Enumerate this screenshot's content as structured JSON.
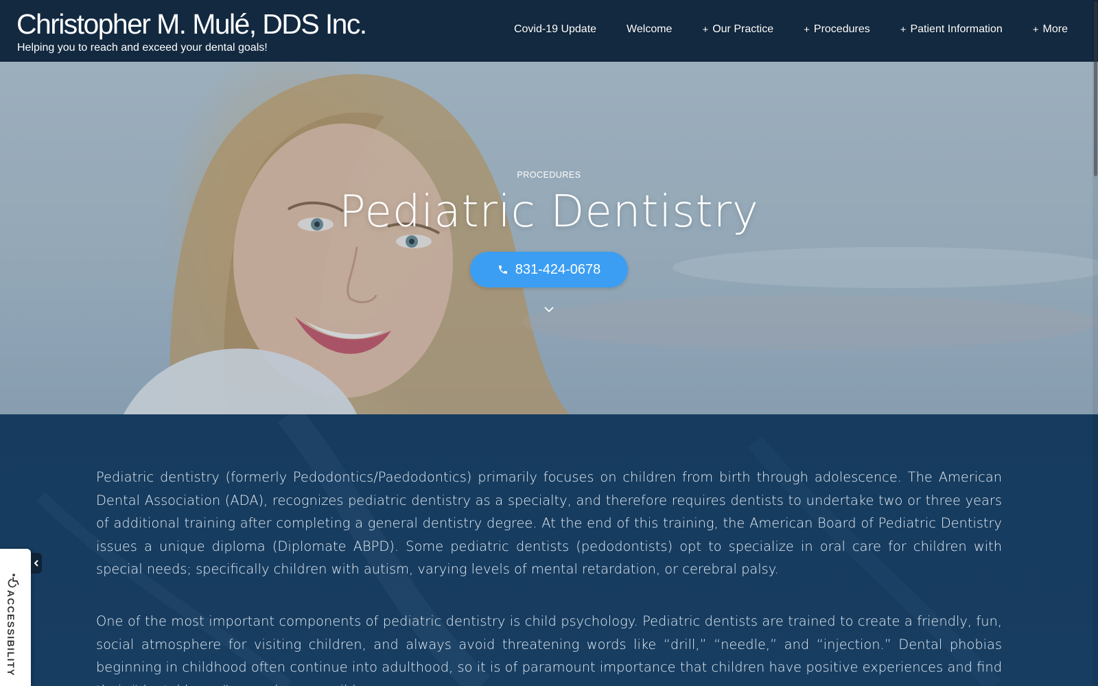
{
  "header": {
    "title": "Christopher M. Mulé, DDS Inc.",
    "tagline": "Helping you to reach and exceed your dental goals!",
    "nav": [
      {
        "label": "Covid-19 Update",
        "has_submenu": false
      },
      {
        "label": "Welcome",
        "has_submenu": false
      },
      {
        "label": "Our Practice",
        "has_submenu": true
      },
      {
        "label": "Procedures",
        "has_submenu": true
      },
      {
        "label": "Patient Information",
        "has_submenu": true
      },
      {
        "label": "More",
        "has_submenu": true
      }
    ]
  },
  "hero": {
    "eyebrow": "PROCEDURES",
    "title": "Pediatric Dentistry",
    "phone": "831-424-0678"
  },
  "content": {
    "paragraphs": [
      "Pediatric dentistry (formerly Pedodontics/Paedodontics) primarily focuses on children from birth through adolescence.  The American Dental Association (ADA), recognizes pediatric dentistry as a specialty, and therefore requires dentists to undertake two or three years of additional training after completing a general dentistry degree.  At the end of this training, the American Board of Pediatric Dentistry issues a unique diploma (Diplomate ABPD).  Some pediatric dentists (pedodontists) opt to specialize in oral care for children with special needs; specifically children with autism, varying levels of mental retardation, or cerebral palsy.",
      "One of the most important components of pediatric dentistry is child psychology.  Pediatric dentists are trained to create a friendly, fun, social atmosphere for visiting children, and always avoid threatening words like “drill,” “needle,” and “injection.”  Dental phobias beginning in childhood often continue into adulthood, so it is of paramount importance that children have positive experiences and find their “dental home” as early as possible."
    ]
  },
  "accessibility": {
    "label": "ACCESSIBILITY"
  },
  "colors": {
    "header_bg": "#12283e",
    "accent_button": "#3b9ef2",
    "content_bg": "#163b5e"
  }
}
